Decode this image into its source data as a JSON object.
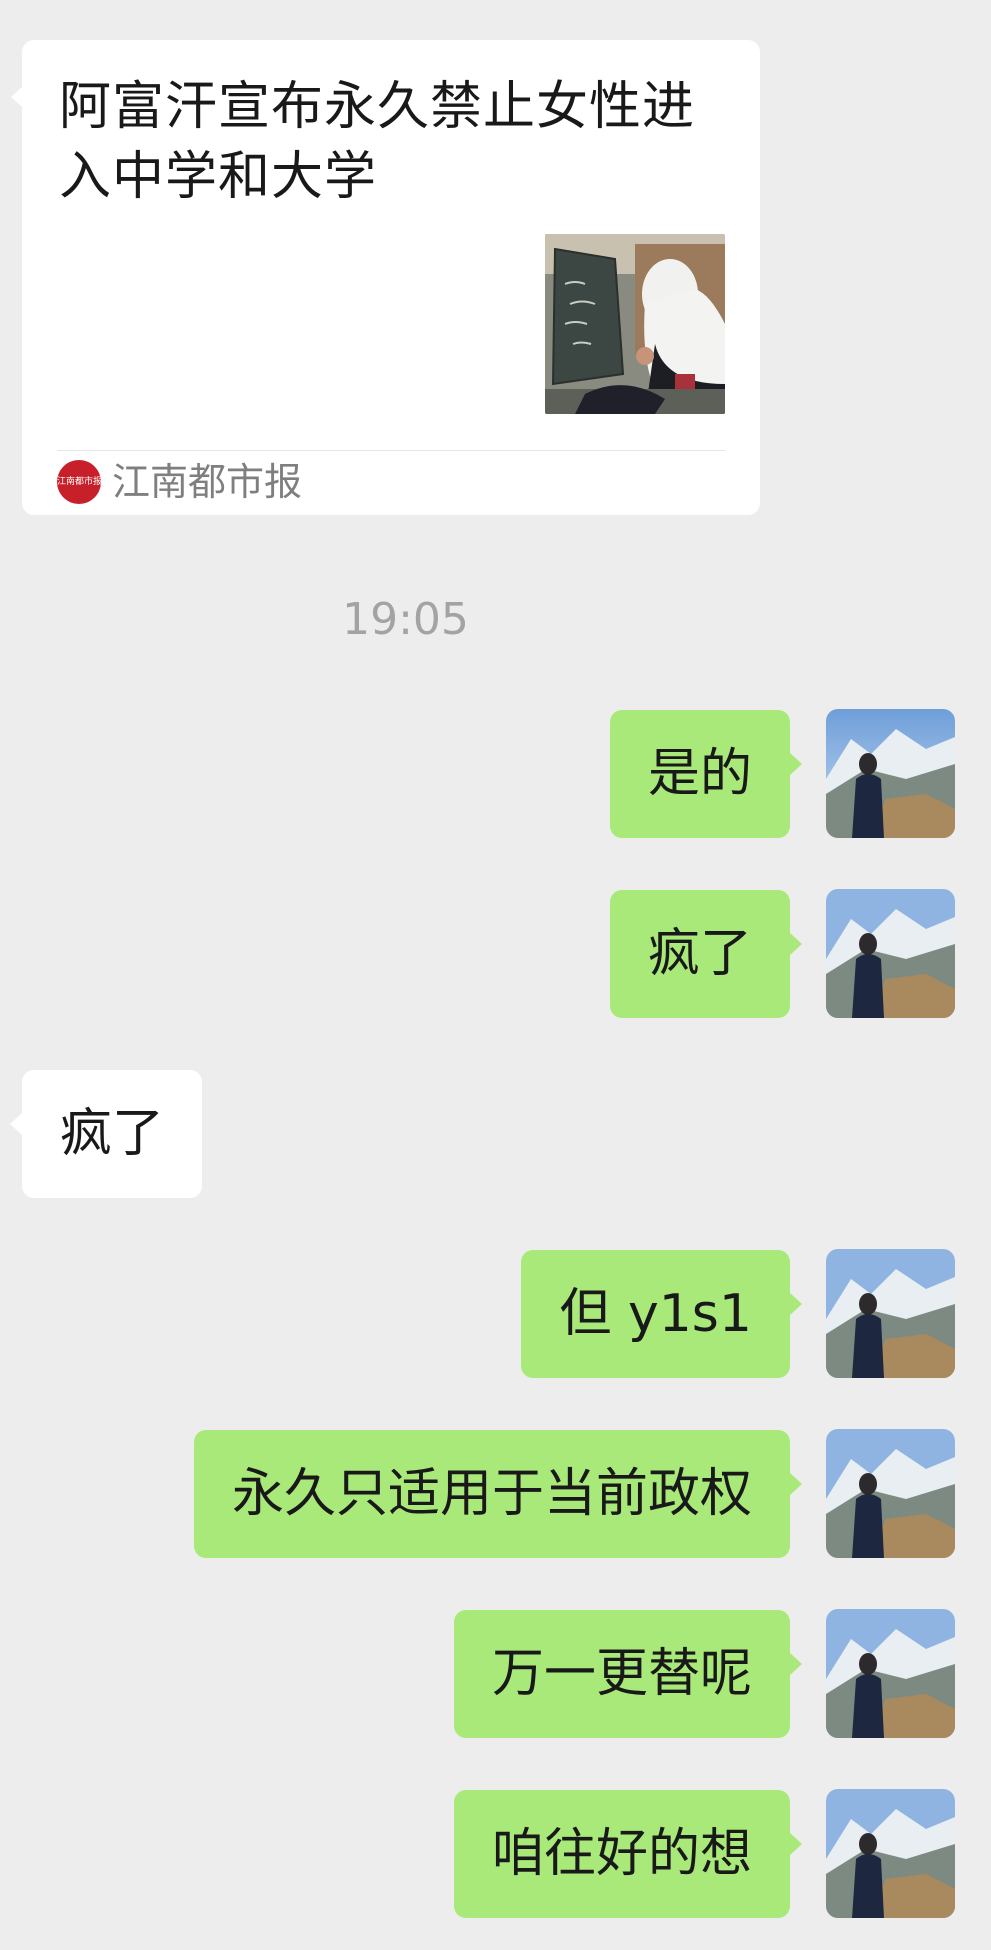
{
  "article": {
    "title": "阿富汗宣布永久禁止女性进入中学和大学",
    "source_logo_text": "江南都市报",
    "source_name": "江南都市报",
    "thumbnail_icon": "blackboard-photo"
  },
  "timestamp": "19:05",
  "messages": [
    {
      "side": "out",
      "text": "是的"
    },
    {
      "side": "out",
      "text": "疯了"
    },
    {
      "side": "in",
      "text": "疯了"
    },
    {
      "side": "out",
      "text": "但 y1s1"
    },
    {
      "side": "out",
      "text": "永久只适用于当前政权"
    },
    {
      "side": "out",
      "text": "万一更替呢"
    },
    {
      "side": "out",
      "text": "咱往好的想"
    }
  ],
  "colors": {
    "background": "#ededed",
    "outgoing_bubble": "#a9e97a",
    "incoming_bubble": "#ffffff",
    "source_logo": "#c8202a"
  }
}
